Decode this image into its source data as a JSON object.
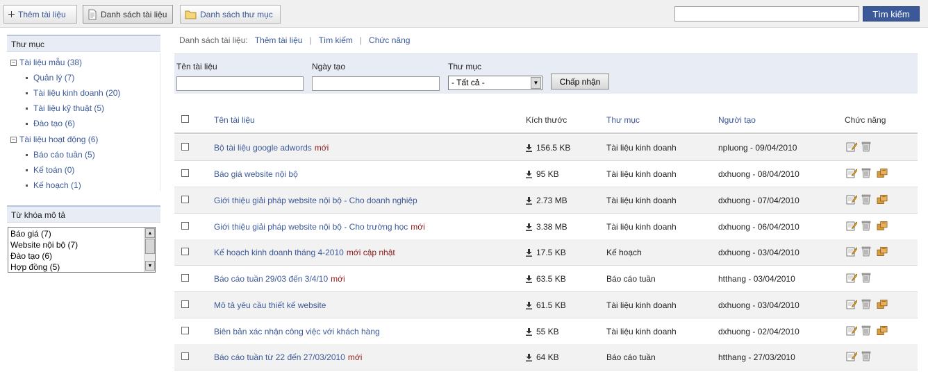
{
  "toolbar": {
    "add_label": "Thêm tài liệu",
    "list_label": "Danh sách tài liệu",
    "folders_label": "Danh sách thư mục",
    "search_placeholder": "",
    "search_button": "Tìm kiếm"
  },
  "sidebar": {
    "folders_title": "Thư mục",
    "tree": [
      {
        "label": "Tài liệu mẫu (38)",
        "level": 0,
        "expanded": true
      },
      {
        "label": "Quản lý (7)",
        "level": 1
      },
      {
        "label": "Tài liệu kinh doanh (20)",
        "level": 1
      },
      {
        "label": "Tài liệu kỹ thuật (5)",
        "level": 1
      },
      {
        "label": "Đào tạo (6)",
        "level": 1
      },
      {
        "label": "Tài liệu hoạt động (6)",
        "level": 0,
        "expanded": true
      },
      {
        "label": "Báo cáo tuần (5)",
        "level": 1
      },
      {
        "label": "Kế toán (0)",
        "level": 1
      },
      {
        "label": "Kế hoạch (1)",
        "level": 1
      }
    ],
    "keywords_title": "Từ khóa mô tả",
    "keywords": [
      "Báo giá (7)",
      "Website nội bộ (7)",
      "Đào tạo (6)",
      "Hợp đồng (5)"
    ]
  },
  "breadcrumb": {
    "label": "Danh sách tài liệu:",
    "links": [
      "Thêm tài liệu",
      "Tìm kiếm",
      "Chức năng"
    ]
  },
  "filter": {
    "name_label": "Tên tài liệu",
    "date_label": "Ngày tạo",
    "folder_label": "Thư mục",
    "folder_selected": "- Tất cả -",
    "apply_button": "Chấp nhận"
  },
  "table": {
    "headers": {
      "name": "Tên tài liệu",
      "size": "Kích thước",
      "folder": "Thư mục",
      "creator": "Người tạo",
      "actions": "Chức năng"
    },
    "rows": [
      {
        "name": "Bộ tài liệu google adwords",
        "tag": "mới",
        "size": "156.5 KB",
        "folder": "Tài liệu kinh doanh",
        "creator": "npluong - 09/04/2010",
        "extra_action": false
      },
      {
        "name": "Báo giá website nội bộ",
        "tag": "",
        "size": "95 KB",
        "folder": "Tài liệu kinh doanh",
        "creator": "dxhuong - 08/04/2010",
        "extra_action": true
      },
      {
        "name": "Giới thiệu giải pháp website nội bộ - Cho doanh nghiệp",
        "tag": "",
        "size": "2.73 MB",
        "folder": "Tài liệu kinh doanh",
        "creator": "dxhuong - 07/04/2010",
        "extra_action": true
      },
      {
        "name": "Giới thiệu giải pháp website nội bộ - Cho trường học",
        "tag": "mới",
        "size": "3.38 MB",
        "folder": "Tài liệu kinh doanh",
        "creator": "dxhuong - 06/04/2010",
        "extra_action": true
      },
      {
        "name": "Kế hoạch kinh doanh tháng 4-2010",
        "tag": "mới cập nhật",
        "size": "17.5 KB",
        "folder": "Kế hoạch",
        "creator": "dxhuong - 03/04/2010",
        "extra_action": true
      },
      {
        "name": "Báo cáo tuần 29/03 đến 3/4/10",
        "tag": "mới",
        "size": "63.5 KB",
        "folder": "Báo cáo tuần",
        "creator": "htthang - 03/04/2010",
        "extra_action": false
      },
      {
        "name": "Mô tả yêu cầu thiết kế website",
        "tag": "",
        "size": "61.5 KB",
        "folder": "Tài liệu kinh doanh",
        "creator": "dxhuong - 03/04/2010",
        "extra_action": true
      },
      {
        "name": "Biên bản xác nhận công việc với khách hàng",
        "tag": "",
        "size": "55 KB",
        "folder": "Tài liệu kinh doanh",
        "creator": "dxhuong - 02/04/2010",
        "extra_action": true
      },
      {
        "name": "Báo cáo tuần từ 22 đến 27/03/2010",
        "tag": "mới",
        "size": "64 KB",
        "folder": "Báo cáo tuần",
        "creator": "htthang - 27/03/2010",
        "extra_action": false
      }
    ]
  },
  "colors": {
    "accent": "#3b5998",
    "tag": "#8b1a1a",
    "panel": "#e8ecf5"
  }
}
